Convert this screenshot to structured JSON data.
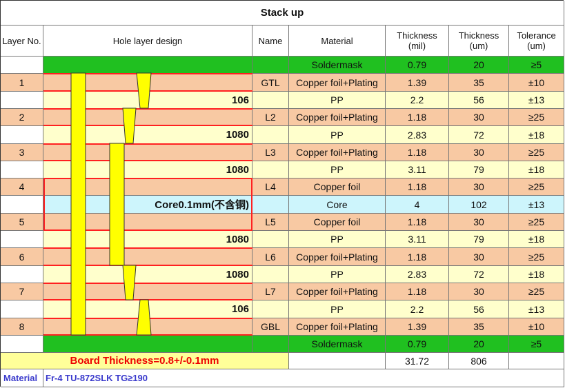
{
  "title": "Stack up",
  "headers": {
    "layer_no": "Layer No.",
    "hole_design": "Hole layer design",
    "name": "Name",
    "material": "Material",
    "thickness_mil": "Thickness\n(mil)",
    "thickness_um": "Thickness\n(um)",
    "tolerance": "Tolerance\n(um)"
  },
  "rows": [
    {
      "layer": "",
      "label": "",
      "name": "",
      "material": "Soldermask",
      "mil": "0.79",
      "um": "20",
      "tol": "≥5",
      "kind": "sm"
    },
    {
      "layer": "1",
      "label": "",
      "name": "GTL",
      "material": "Copper foil+Plating",
      "mil": "1.39",
      "um": "35",
      "tol": "±10",
      "kind": "cu"
    },
    {
      "layer": "",
      "label": "106",
      "name": "",
      "material": "PP",
      "mil": "2.2",
      "um": "56",
      "tol": "±13",
      "kind": "pp"
    },
    {
      "layer": "2",
      "label": "",
      "name": "L2",
      "material": "Copper foil+Plating",
      "mil": "1.18",
      "um": "30",
      "tol": "≥25",
      "kind": "cu"
    },
    {
      "layer": "",
      "label": "1080",
      "name": "",
      "material": "PP",
      "mil": "2.83",
      "um": "72",
      "tol": "±18",
      "kind": "pp"
    },
    {
      "layer": "3",
      "label": "",
      "name": "L3",
      "material": "Copper foil+Plating",
      "mil": "1.18",
      "um": "30",
      "tol": "≥25",
      "kind": "cu"
    },
    {
      "layer": "",
      "label": "1080",
      "name": "",
      "material": "PP",
      "mil": "3.11",
      "um": "79",
      "tol": "±18",
      "kind": "pp"
    },
    {
      "layer": "4",
      "label": "",
      "name": "L4",
      "material": "Copper foil",
      "mil": "1.18",
      "um": "30",
      "tol": "≥25",
      "kind": "cu"
    },
    {
      "layer": "",
      "label": "Core0.1mm(不含铜)",
      "name": "",
      "material": "Core",
      "mil": "4",
      "um": "102",
      "tol": "±13",
      "kind": "core"
    },
    {
      "layer": "5",
      "label": "",
      "name": "L5",
      "material": "Copper foil",
      "mil": "1.18",
      "um": "30",
      "tol": "≥25",
      "kind": "cu"
    },
    {
      "layer": "",
      "label": "1080",
      "name": "",
      "material": "PP",
      "mil": "3.11",
      "um": "79",
      "tol": "±18",
      "kind": "pp"
    },
    {
      "layer": "6",
      "label": "",
      "name": "L6",
      "material": "Copper foil+Plating",
      "mil": "1.18",
      "um": "30",
      "tol": "≥25",
      "kind": "cu"
    },
    {
      "layer": "",
      "label": "1080",
      "name": "",
      "material": "PP",
      "mil": "2.83",
      "um": "72",
      "tol": "±18",
      "kind": "pp"
    },
    {
      "layer": "7",
      "label": "",
      "name": "L7",
      "material": "Copper foil+Plating",
      "mil": "1.18",
      "um": "30",
      "tol": "≥25",
      "kind": "cu"
    },
    {
      "layer": "",
      "label": "106",
      "name": "",
      "material": "PP",
      "mil": "2.2",
      "um": "56",
      "tol": "±13",
      "kind": "pp"
    },
    {
      "layer": "8",
      "label": "",
      "name": "GBL",
      "material": "Copper foil+Plating",
      "mil": "1.39",
      "um": "35",
      "tol": "±10",
      "kind": "cu"
    },
    {
      "layer": "",
      "label": "",
      "name": "",
      "material": "Soldermask",
      "mil": "0.79",
      "um": "20",
      "tol": "≥5",
      "kind": "sm"
    }
  ],
  "footer": {
    "board_thickness": "Board Thickness=0.8+/-0.1mm",
    "total_mil": "31.72",
    "total_um": "806",
    "material_label": "Material",
    "material_spec": "Fr-4  TU-872SLK  TG≥190"
  },
  "colors": {
    "copper": "#f8c9a3",
    "prepreg": "#ffffcc",
    "core": "#cdf5fc",
    "soldermask": "#20c020",
    "hole": "#ffff00",
    "highlight": "#ff2020"
  }
}
